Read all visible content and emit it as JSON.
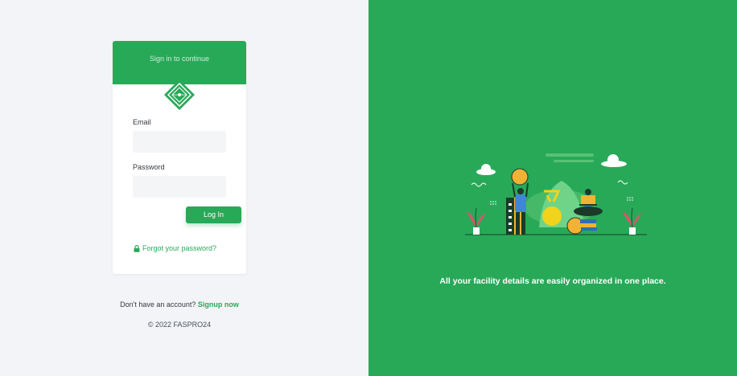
{
  "login": {
    "header_subtitle": "Sign in to continue",
    "email_label": "Email",
    "email_value": "",
    "password_label": "Password",
    "password_value": "",
    "login_button": "Log In",
    "forgot_link": "Forgot your password?"
  },
  "footer": {
    "no_account_text": "Don't have an account?",
    "signup_link": "Signup now",
    "copyright": "© 2022 FASPRO24"
  },
  "promo": {
    "tagline": "All your facility details are easily organized in one place."
  },
  "colors": {
    "brand_green": "#28a958",
    "left_background": "#f3f4f7"
  }
}
